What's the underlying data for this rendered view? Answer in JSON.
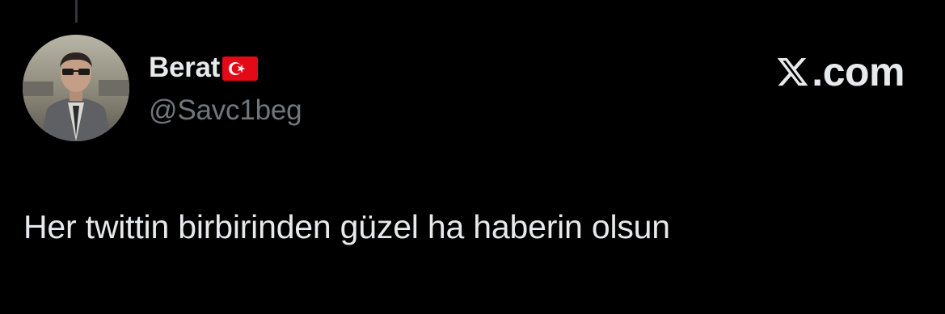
{
  "tweet": {
    "author": {
      "display_name": "Berat",
      "flag_icon": "turkey-flag-icon",
      "handle": "@Savc1beg",
      "avatar_icon": "profile-photo-avatar"
    },
    "text": "Her twittin birbirinden güzel ha haberin olsun"
  },
  "brand": {
    "logo_icon": "x-logo-icon",
    "text": ".com"
  },
  "colors": {
    "background": "#000000",
    "primary_text": "#e7e9ea",
    "secondary_text": "#71767b",
    "thread_line": "#333639",
    "flag_red": "#e30a17"
  }
}
